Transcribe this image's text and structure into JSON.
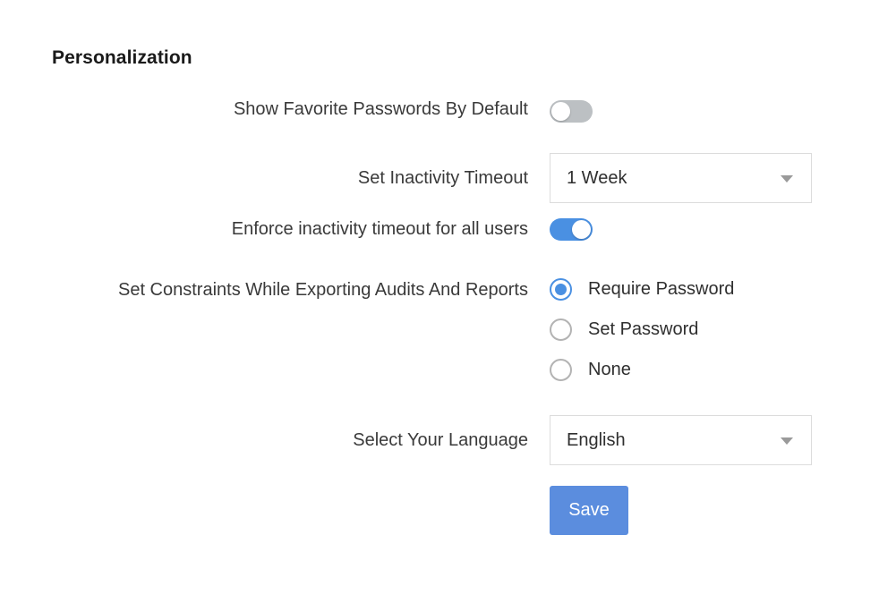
{
  "page": {
    "title": "Personalization",
    "background_color": "#ffffff",
    "accent_color": "#4a90e2",
    "button_color": "#5b8dde"
  },
  "rows": {
    "favorite_passwords": {
      "label": "Show Favorite Passwords By Default",
      "toggle_state": "off"
    },
    "inactivity_timeout": {
      "label": "Set Inactivity Timeout",
      "value": "1 Week",
      "icon": "chevron-down-icon"
    },
    "enforce_timeout": {
      "label": "Enforce inactivity timeout for all users",
      "toggle_state": "on"
    },
    "export_constraints": {
      "label": "Set Constraints While Exporting Audits And Reports",
      "options": [
        {
          "label": "Require Password",
          "selected": true
        },
        {
          "label": "Set Password",
          "selected": false
        },
        {
          "label": "None",
          "selected": false
        }
      ]
    },
    "language": {
      "label": "Select Your Language",
      "value": "English",
      "icon": "chevron-down-icon"
    }
  },
  "actions": {
    "save_label": "Save"
  }
}
